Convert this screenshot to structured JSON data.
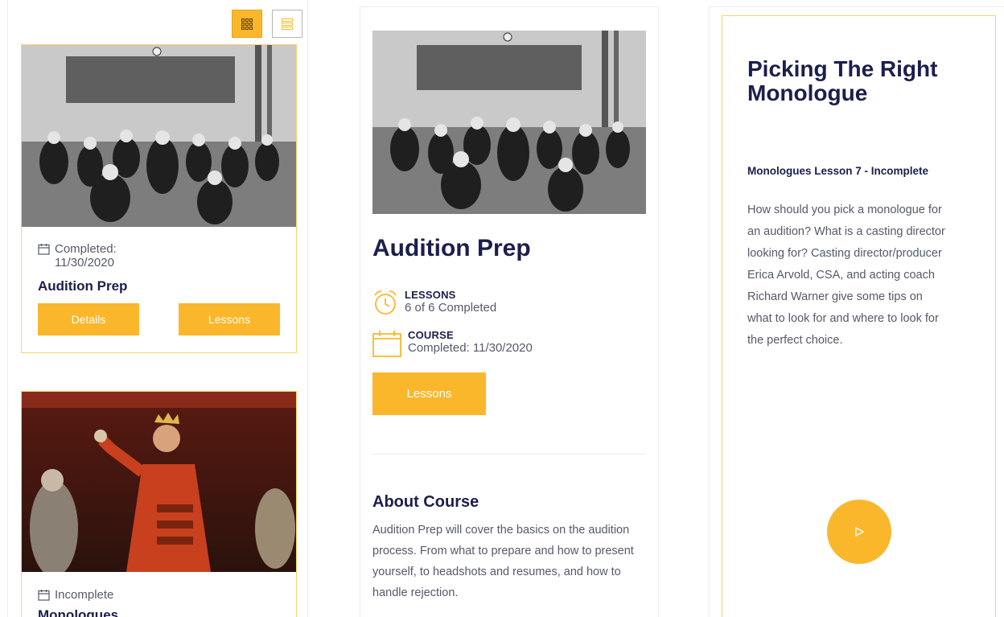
{
  "colors": {
    "accent": "#fbb72c",
    "heading": "#1c1e4b",
    "text": "#55596a",
    "border": "#fbd36a"
  },
  "toolbar": {
    "grid_icon": "grid-icon",
    "list_icon": "list-icon"
  },
  "cards": [
    {
      "status": "Completed: 11/30/2020",
      "status_line1": "Completed:",
      "status_line2": "11/30/2020",
      "title": "Audition Prep",
      "details_label": "Details",
      "lessons_label": "Lessons",
      "icon": "calendar-icon"
    },
    {
      "status": "Incomplete",
      "title": "Monologues",
      "icon": "calendar-icon"
    }
  ],
  "course": {
    "title": "Audition Prep",
    "lessons_label": "LESSONS",
    "lessons_value": "6 of 6 Completed",
    "lessons_icon": "alarm-clock-icon",
    "course_label": "COURSE",
    "course_value": "Completed: 11/30/2020",
    "course_icon": "calendar-icon",
    "lessons_button": "Lessons",
    "about_title": "About Course",
    "about_text": "Audition Prep will cover the basics on the audition process. From what to prepare and how to present yourself, to headshots and resumes, and how to handle rejection."
  },
  "lesson": {
    "title": "Picking The Right Monologue",
    "subtitle": "Monologues Lesson 7 - Incomplete",
    "description": "How should you pick a monologue for an audition? What is a casting director looking for? Casting director/producer Erica Arvold, CSA, and acting coach Richard Warner give some tips on what to look for and where to look for the perfect choice.",
    "play_icon": "play-icon"
  }
}
